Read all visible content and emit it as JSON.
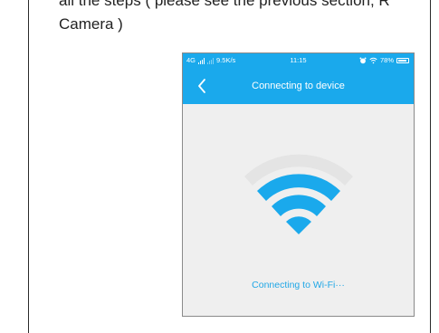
{
  "document": {
    "line1": "all the steps ( please see the previous section, R",
    "line2": "Camera )"
  },
  "phone": {
    "status_bar": {
      "network": "4G",
      "speed": "9.5K/s",
      "time": "11:15",
      "battery": "78%"
    },
    "nav": {
      "title": "Connecting to device"
    },
    "content": {
      "status_message": "Connecting to Wi-Fi···"
    },
    "colors": {
      "accent": "#1aa9ec",
      "wifi_active": "#1aa9ec",
      "wifi_inactive": "#e4e4e4",
      "background": "#efefef"
    },
    "icons": [
      "back-arrow-icon",
      "wifi-icon",
      "alarm-icon",
      "wifi-status-icon",
      "battery-icon"
    ]
  }
}
